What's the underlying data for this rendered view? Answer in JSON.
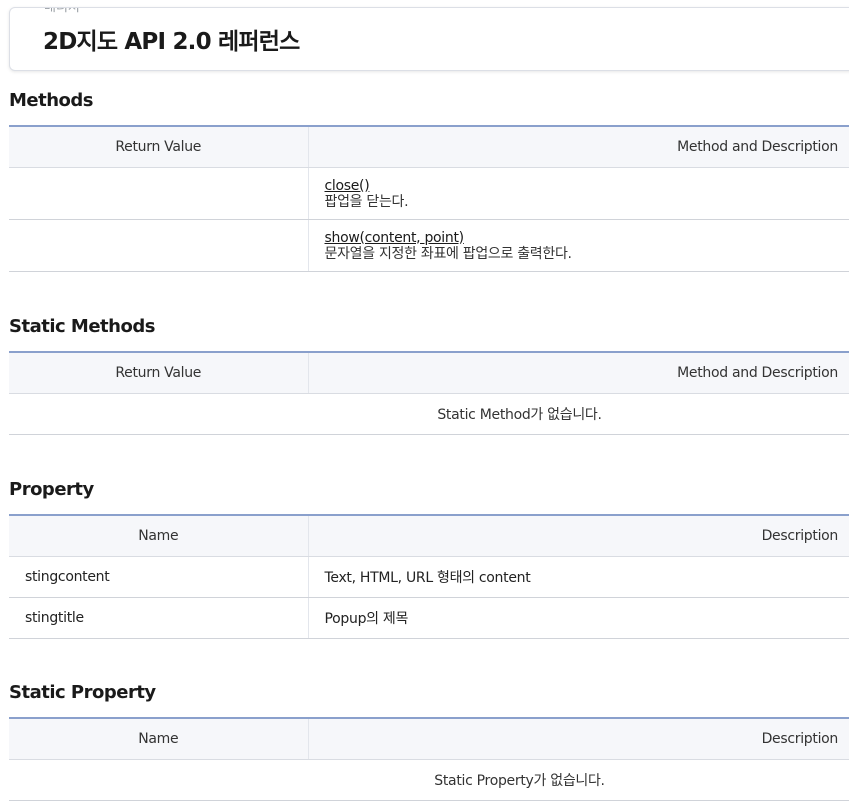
{
  "header": {
    "cutoff_text": "배너처",
    "title": "2D지도 API 2.0 레퍼런스"
  },
  "methods": {
    "title": "Methods",
    "columns": [
      "Return Value",
      "Method and Description"
    ],
    "rows": [
      {
        "return_value": "",
        "name": "close()",
        "description": "팝업을 닫는다."
      },
      {
        "return_value": "",
        "name": "show(content, point)",
        "description": "문자열을 지정한 좌표에 팝업으로 출력한다."
      }
    ]
  },
  "static_methods": {
    "title": "Static Methods",
    "columns": [
      "Return Value",
      "Method and Description"
    ],
    "empty_message": "Static Method가 없습니다."
  },
  "property": {
    "title": "Property",
    "columns": [
      "Name",
      "Description"
    ],
    "rows": [
      {
        "name": "stingcontent",
        "description": "Text, HTML, URL 형태의 content"
      },
      {
        "name": "stingtitle",
        "description": "Popup의 제목"
      }
    ]
  },
  "static_property": {
    "title": "Static Property",
    "columns": [
      "Name",
      "Description"
    ],
    "empty_message": "Static Property가 없습니다."
  }
}
